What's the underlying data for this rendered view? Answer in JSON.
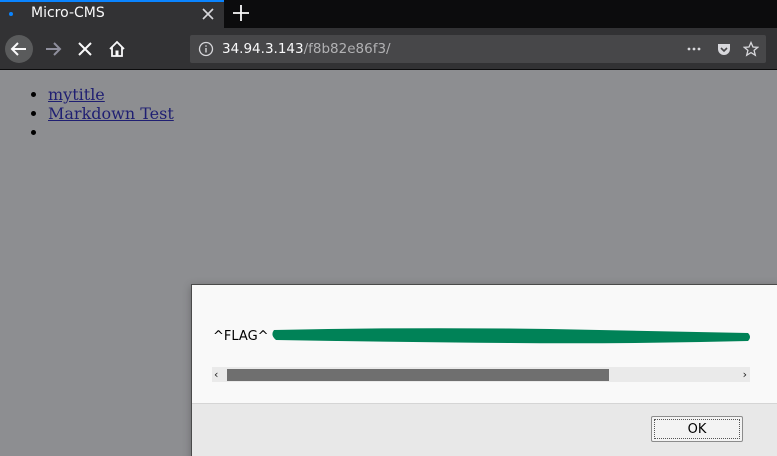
{
  "browser": {
    "tab": {
      "title": "Micro-CMS",
      "close_icon": "close-icon"
    },
    "new_tab_icon": "plus-icon",
    "nav": {
      "back_icon": "arrow-left-icon",
      "forward_icon": "arrow-right-icon",
      "stop_icon": "stop-x-icon",
      "home_icon": "home-icon"
    },
    "url": {
      "host": "34.94.3.143",
      "path": "/f8b82e86f3/"
    },
    "url_icons": [
      "info-icon",
      "more-dots-icon",
      "pocket-icon",
      "star-icon"
    ]
  },
  "page": {
    "links": [
      "mytitle",
      "Markdown Test",
      ""
    ]
  },
  "dialog": {
    "message": "^FLAG^",
    "ok_label": "OK"
  },
  "colors": {
    "tab_accent": "#0a84ff",
    "page_bg": "#8d8e91",
    "redaction": "#008257",
    "link": "#1f1f72"
  }
}
